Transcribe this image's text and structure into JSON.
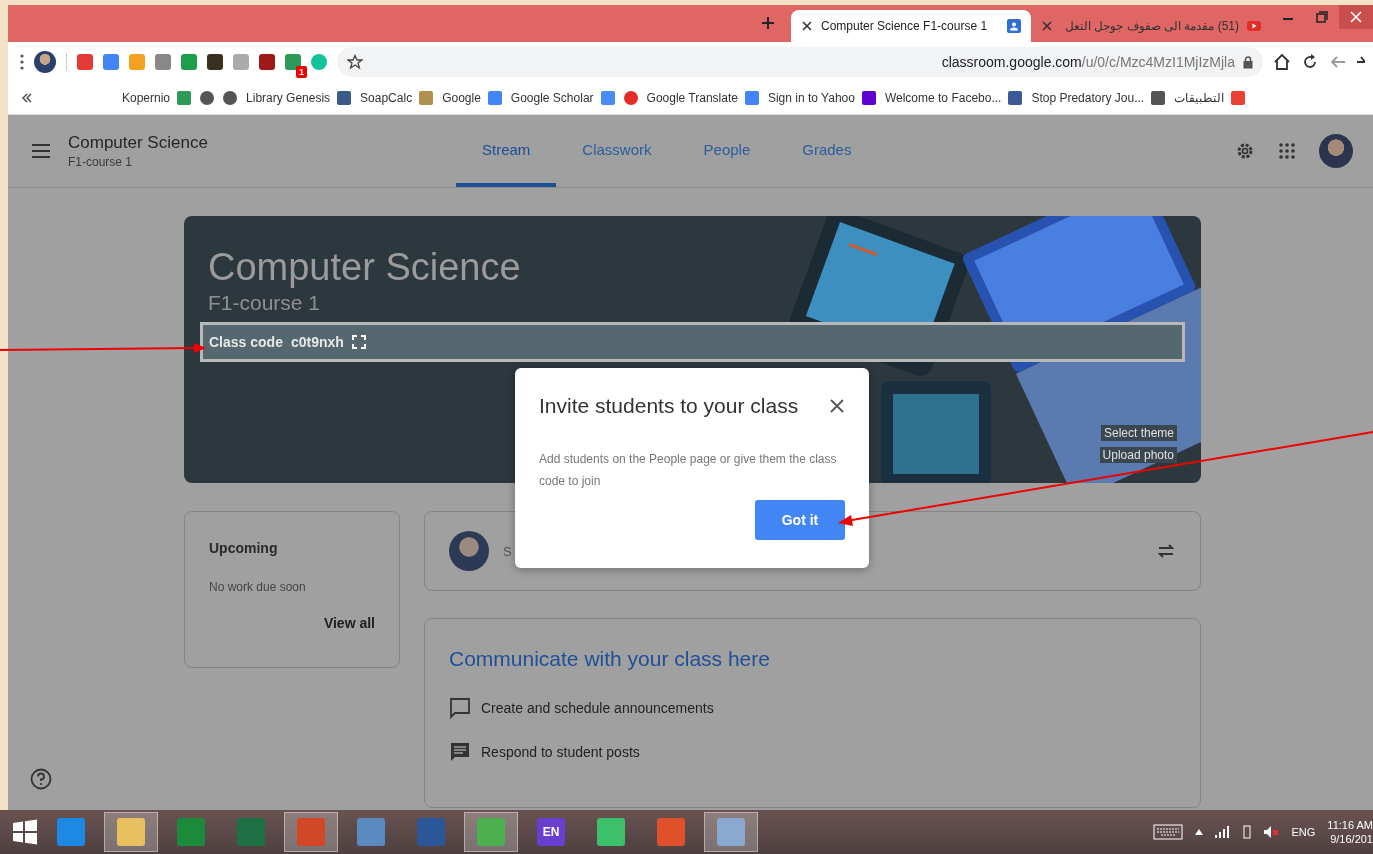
{
  "browser": {
    "tabs": [
      {
        "title": "Computer Science F1-course 1",
        "selected": true,
        "kind": "person"
      },
      {
        "title": "(51) مقدمة الى صفوف جوجل التعل",
        "selected": false,
        "kind": "play"
      }
    ],
    "extension_badge": "1",
    "address": {
      "host": "classroom.google.com",
      "path": "/u/0/c/Mzc4MzI1MjIzMjla"
    },
    "bookmarks": [
      {
        "kind": "labeled",
        "label": "Kopernio",
        "color": "#2e9a5a"
      },
      {
        "kind": "icon",
        "color": "#555555"
      },
      {
        "kind": "icon",
        "color": "#555555"
      },
      {
        "kind": "labeled",
        "label": "Library Genesis",
        "color": "#3a5a8a"
      },
      {
        "kind": "labeled",
        "label": "SoapCalc",
        "color": "#b09050"
      },
      {
        "kind": "labeled",
        "label": "Google",
        "color": "#4285f4"
      },
      {
        "kind": "labeled",
        "label": "Google Scholar",
        "color": "#4a8af4"
      },
      {
        "kind": "icon",
        "color": "#e52d27"
      },
      {
        "kind": "labeled",
        "label": "Google Translate",
        "color": "#4285f4"
      },
      {
        "kind": "labeled",
        "label": "Sign in to Yahoo",
        "color": "#5f01d1"
      },
      {
        "kind": "labeled",
        "label": "Welcome to Facebo...",
        "color": "#3b5998"
      },
      {
        "kind": "labeled",
        "label": "Stop Predatory Jou...",
        "color": "#555555"
      },
      {
        "kind": "labeled",
        "label": "التطبيقات",
        "color": "#e94235"
      }
    ]
  },
  "classroom": {
    "title": "Computer Science",
    "subtitle": "F1-course 1",
    "tabs": [
      {
        "label": "Stream",
        "selected": true
      },
      {
        "label": "Classwork",
        "selected": false
      },
      {
        "label": "People",
        "selected": false
      },
      {
        "label": "Grades",
        "selected": false
      }
    ],
    "banner": {
      "title": "Computer Science",
      "section": "F1-course 1",
      "class_code_label": "Class code",
      "class_code": "c0t9nxh",
      "links": [
        "Select theme",
        "Upload photo"
      ]
    },
    "upcoming": {
      "title": "Upcoming",
      "text": "No work due soon",
      "link": "View all"
    },
    "post_prompt": "S",
    "communicate": {
      "title": "Communicate with your class here",
      "items": [
        {
          "kind": "announce",
          "text": "Create and schedule announcements"
        },
        {
          "kind": "respond",
          "text": "Respond to student posts"
        }
      ]
    }
  },
  "dialog": {
    "title": "Invite students to your class",
    "body": "Add students on the People page or give them the class code to join",
    "button": "Got it"
  },
  "taskbar": {
    "apps": [
      {
        "kind": "icon",
        "color": "#1e88e5",
        "selected": false
      },
      {
        "kind": "icon",
        "color": "#e8c060",
        "selected": true
      },
      {
        "kind": "icon",
        "color": "#1b8a3a",
        "selected": false
      },
      {
        "kind": "icon",
        "color": "#1d7044",
        "selected": false
      },
      {
        "kind": "icon",
        "color": "#d24726",
        "selected": true
      },
      {
        "kind": "icon",
        "color": "#5a8ac0",
        "selected": false
      },
      {
        "kind": "icon",
        "color": "#2b579a",
        "selected": false
      },
      {
        "kind": "icon",
        "color": "#4caf50",
        "selected": true
      },
      {
        "kind": "text",
        "label": "EN",
        "color": "#6a3fd0",
        "selected": false
      },
      {
        "kind": "icon",
        "color": "#3cc06a",
        "selected": false
      },
      {
        "kind": "icon",
        "color": "#e0502a",
        "selected": false
      },
      {
        "kind": "icon",
        "color": "#8aa8d0",
        "selected": true
      }
    ],
    "language": "ENG",
    "time": "11:16 AM",
    "date": "9/16/201"
  }
}
